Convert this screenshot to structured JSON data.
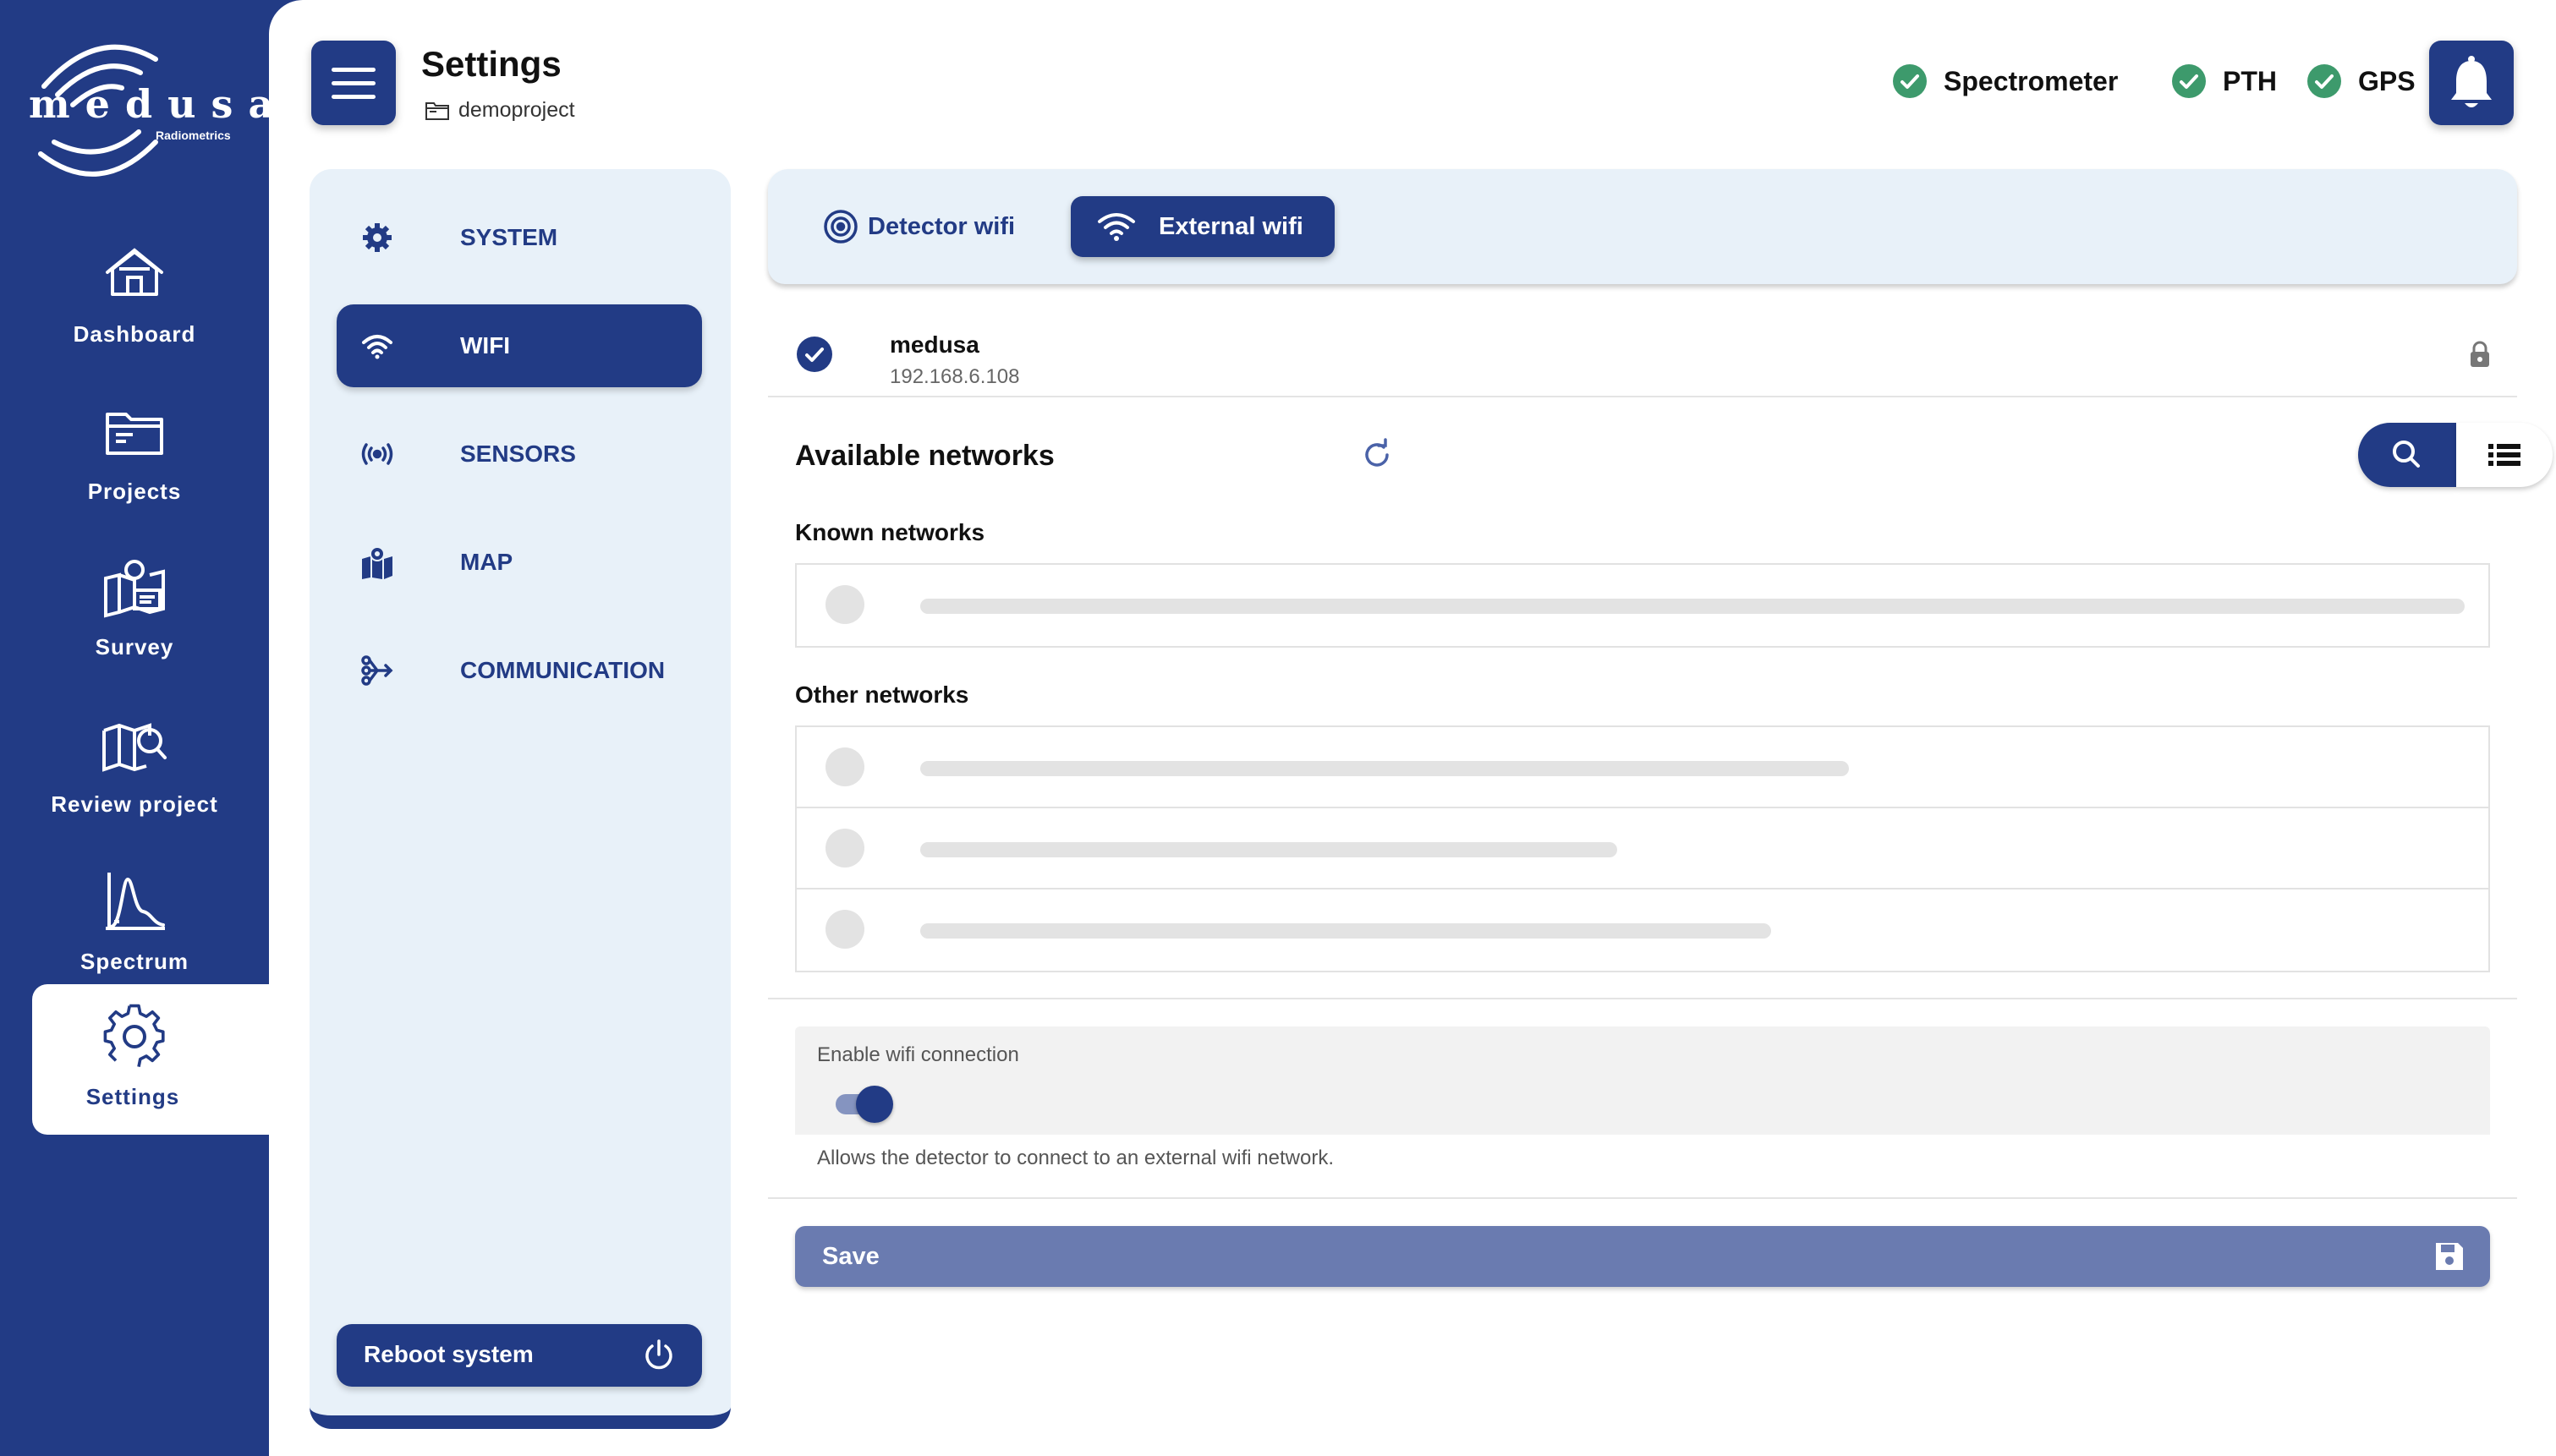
{
  "brand": {
    "name": "medusa",
    "subtitle": "Radiometrics"
  },
  "nav": {
    "items": [
      {
        "label": "Dashboard",
        "icon": "home-icon"
      },
      {
        "label": "Projects",
        "icon": "folder-icon"
      },
      {
        "label": "Survey",
        "icon": "survey-map-icon"
      },
      {
        "label": "Review project",
        "icon": "map-search-icon"
      },
      {
        "label": "Spectrum",
        "icon": "spectrum-chart-icon"
      },
      {
        "label": "Settings",
        "icon": "gear-icon",
        "active": true
      }
    ]
  },
  "header": {
    "title": "Settings",
    "project": "demoproject",
    "statuses": [
      {
        "label": "Spectrometer",
        "state": "ok"
      },
      {
        "label": "PTH",
        "state": "ok"
      },
      {
        "label": "GPS",
        "state": "ok"
      }
    ]
  },
  "settings_menu": {
    "items": [
      {
        "label": "SYSTEM",
        "icon": "cog-icon"
      },
      {
        "label": "WIFI",
        "icon": "wifi-icon",
        "active": true
      },
      {
        "label": "SENSORS",
        "icon": "broadcast-icon"
      },
      {
        "label": "MAP",
        "icon": "map-pin-icon"
      },
      {
        "label": "COMMUNICATION",
        "icon": "network-icon"
      }
    ],
    "reboot_label": "Reboot system"
  },
  "wifi": {
    "tabs": [
      {
        "label": "Detector wifi",
        "icon": "access-point-icon"
      },
      {
        "label": "External wifi",
        "icon": "wifi-icon",
        "active": true
      }
    ],
    "connected": {
      "ssid": "medusa",
      "ip": "192.168.6.108",
      "secured": true
    },
    "available_title": "Available networks",
    "known_title": "Known networks",
    "other_title": "Other networks",
    "known_placeholder_rows": 1,
    "other_placeholder_rows": 3,
    "enable_label": "Enable wifi connection",
    "enabled": true,
    "helper_text": "Allows the detector to connect to an external wifi network.",
    "save_label": "Save"
  },
  "colors": {
    "primary": "#223b85",
    "panel": "#e8f1f9",
    "status_ok": "#3d9a6c",
    "save_disabled": "#6a7bb0"
  }
}
